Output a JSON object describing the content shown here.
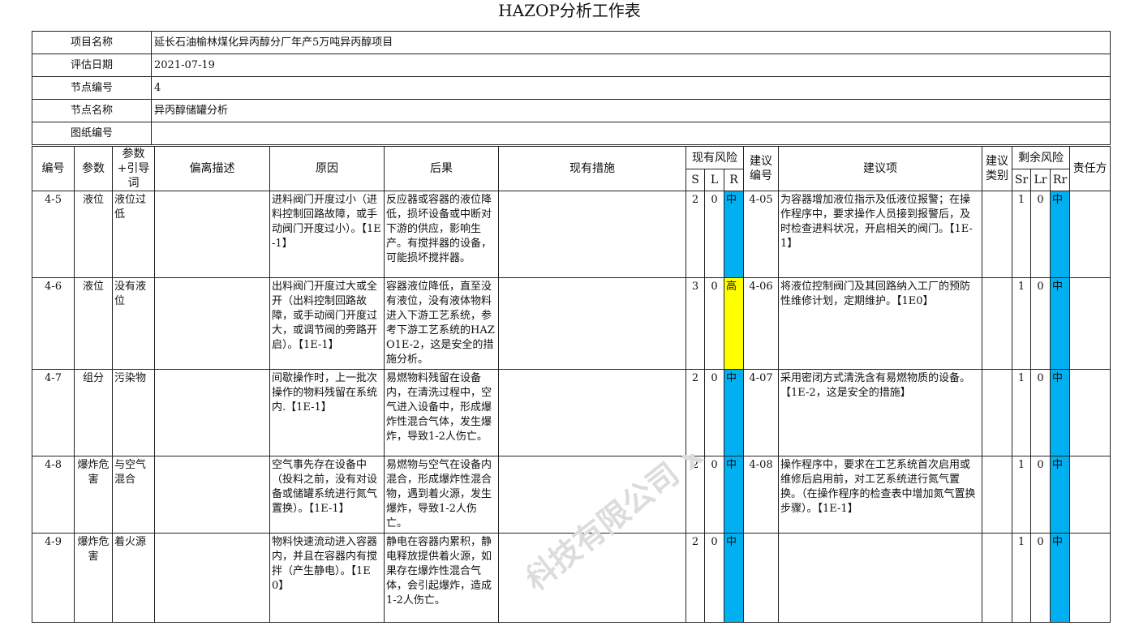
{
  "title": "HAZOP分析工作表",
  "info": [
    {
      "label": "项目名称",
      "value": "延长石油榆林煤化异丙醇分厂年产5万吨异丙醇项目"
    },
    {
      "label": "评估日期",
      "value": "2021-07-19"
    },
    {
      "label": "节点编号",
      "value": "4"
    },
    {
      "label": "节点名称",
      "value": "异丙醇储罐分析"
    },
    {
      "label": "图纸编号",
      "value": ""
    }
  ],
  "headers": {
    "no": "编号",
    "param": "参数",
    "guide": "参数+引导词",
    "deviation": "偏离描述",
    "cause": "原因",
    "consequence": "后果",
    "measures": "现有措施",
    "current_risk": "现有风险",
    "s": "S",
    "l": "L",
    "r": "R",
    "rec_no": "建议编号",
    "rec": "建议项",
    "rec_type": "建议类别",
    "residual_risk": "剩余风险",
    "sr": "Sr",
    "lr": "Lr",
    "rr": "Rr",
    "owner": "责任方"
  },
  "rows": [
    {
      "no": "4-5",
      "param": "液位",
      "guide": "液位过低",
      "deviation": "",
      "cause": "进料阀门开度过小（进料控制回路故障，或手动阀门开度过小）。【1E-1】",
      "consequence": "反应器或容器的液位降低，损坏设备或中断对下游的供应，影响生产。有搅拌器的设备，可能损坏搅拌器。",
      "measures": "",
      "s": "2",
      "l": "0",
      "r": "中",
      "rec_no": "4-05",
      "rec": "为容器增加液位指示及低液位报警；在操作程序中，要求操作人员接到报警后，及时检查进料状况，开启相关的阀门。【1E-1】",
      "rec_type": "",
      "sr": "1",
      "lr": "0",
      "rr": "中",
      "owner": ""
    },
    {
      "no": "4-6",
      "param": "液位",
      "guide": "没有液位",
      "deviation": "",
      "cause": "出料阀门开度过大或全开（出料控制回路故障，或手动阀门开度过大，或调节阀的旁路开启）。【1E-1】",
      "consequence": "容器液位降低，直至没有液位，没有液体物料进入下游工艺系统，参考下游工艺系统的HAZO1E-2，这是安全的措施分析。",
      "measures": "",
      "s": "3",
      "l": "0",
      "r": "高",
      "rec_no": "4-06",
      "rec": "将液位控制阀门及其回路纳入工厂的预防性维修计划，定期维护。【1E0】",
      "rec_type": "",
      "sr": "1",
      "lr": "0",
      "rr": "中",
      "owner": ""
    },
    {
      "no": "4-7",
      "param": "组分",
      "guide": "污染物",
      "deviation": "",
      "cause": "间歇操作时，上一批次操作的物料残留在系统内.【1E-1】",
      "consequence": "易燃物料残留在设备内，在清洗过程中，空气进入设备中，形成爆炸性混合气体，发生爆炸，导致1-2人伤亡。",
      "measures": "",
      "s": "2",
      "l": "0",
      "r": "中",
      "rec_no": "4-07",
      "rec": "采用密闭方式清洗含有易燃物质的设备。【1E-2，这是安全的措施】",
      "rec_type": "",
      "sr": "1",
      "lr": "0",
      "rr": "中",
      "owner": ""
    },
    {
      "no": "4-8",
      "param": "爆炸危害",
      "guide": "与空气混合",
      "deviation": "",
      "cause": "空气事先存在设备中（投料之前，没有对设备或储罐系统进行氮气置换）。【1E-1】",
      "consequence": "易燃物与空气在设备内混合，形成爆炸性混合物，遇到着火源，发生爆炸，导致1-2人伤亡。",
      "measures": "",
      "s": "2",
      "l": "0",
      "r": "中",
      "rec_no": "4-08",
      "rec": "操作程序中，要求在工艺系统首次启用或维修后启用前，对工艺系统进行氮气置换。（在操作程序的检查表中增加氮气置换步骤）。【1E-1】",
      "rec_type": "",
      "sr": "1",
      "lr": "0",
      "rr": "中",
      "owner": ""
    },
    {
      "no": "4-9",
      "param": "爆炸危害",
      "guide": "着火源",
      "deviation": "",
      "cause": "物料快速流动进入容器内，并且在容器内有搅拌（产生静电）。【1E0】",
      "consequence": "静电在容器内累积，静电释放提供着火源，如果存在爆炸性混合气体，会引起爆炸，造成1-2人伤亡。",
      "measures": "",
      "s": "2",
      "l": "0",
      "r": "中",
      "rec_no": "",
      "rec": "",
      "rec_type": "",
      "sr": "1",
      "lr": "0",
      "rr": "中",
      "owner": ""
    }
  ],
  "colors": {
    "risk_mid": "#00b0f0",
    "risk_high": "#ffff00"
  },
  "watermark": "科技有限公司 x-tech.com"
}
